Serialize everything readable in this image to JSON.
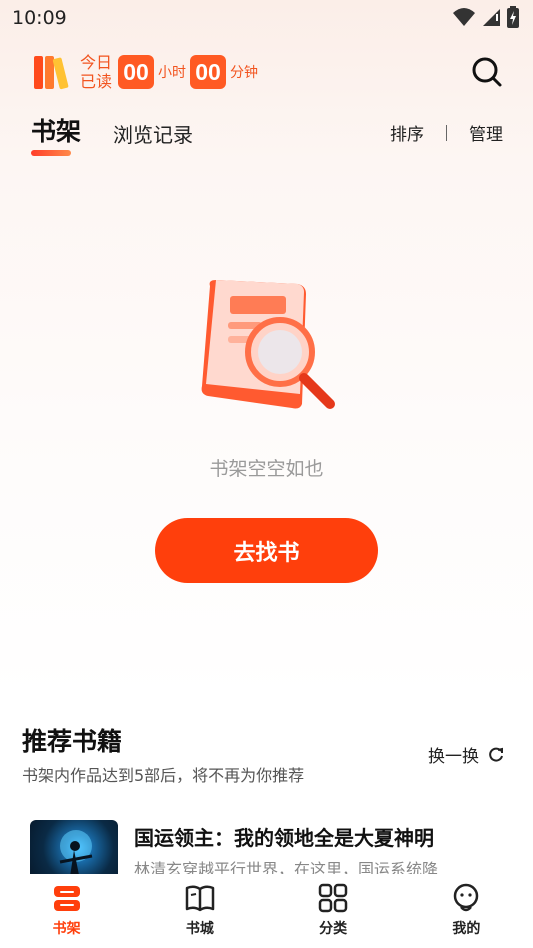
{
  "status": {
    "time": "10:09"
  },
  "reading": {
    "today_line1": "今日",
    "today_line2": "已读",
    "hours": "00",
    "hours_unit": "小时",
    "minutes": "00",
    "minutes_unit": "分钟"
  },
  "tabs": {
    "active": "书架",
    "inactive": "浏览记录"
  },
  "actions": {
    "sort": "排序",
    "manage": "管理"
  },
  "empty": {
    "message": "书架空空如也",
    "button": "去找书"
  },
  "recommend": {
    "title": "推荐书籍",
    "subtitle": "书架内作品达到5部后，将不再为你推荐",
    "refresh": "换一换",
    "books": [
      {
        "title": "国运领主：我的领地全是大夏神明",
        "desc": "林清玄穿越平行世界，在这里，国运系统降"
      }
    ]
  },
  "nav": {
    "items": [
      {
        "label": "书架",
        "icon": "bookshelf-icon"
      },
      {
        "label": "书城",
        "icon": "open-book-icon"
      },
      {
        "label": "分类",
        "icon": "grid-icon"
      },
      {
        "label": "我的",
        "icon": "profile-icon"
      }
    ]
  },
  "colors": {
    "accent": "#ff3f0c",
    "accent_text": "#f2541f"
  }
}
